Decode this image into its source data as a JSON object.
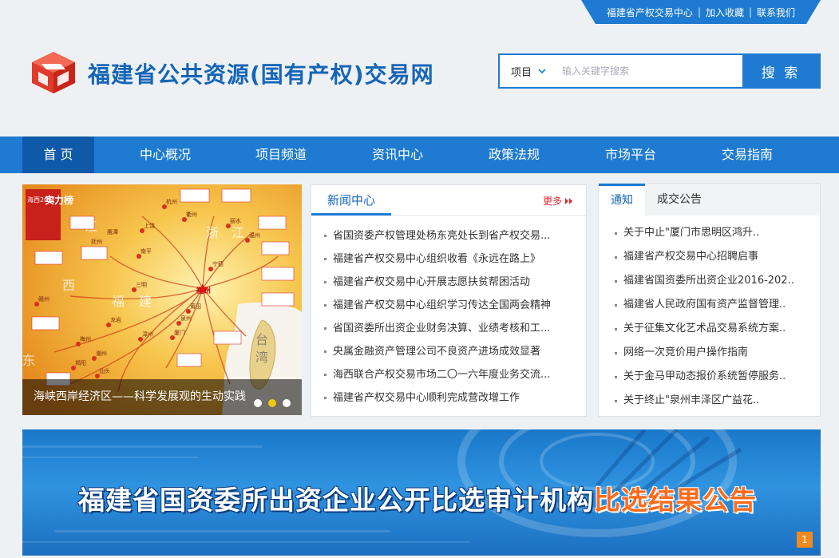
{
  "utility": {
    "links": [
      "福建省产权交易中心",
      "加入收藏",
      "联系我们"
    ],
    "separator": "|"
  },
  "header": {
    "title": "福建省公共资源(国有产权)交易网",
    "logo_icon": "cube-logo-icon"
  },
  "search": {
    "category": "项目",
    "placeholder": "输入关键字搜索",
    "button": "搜 索"
  },
  "nav": {
    "items": [
      "首 页",
      "中心概况",
      "项目频道",
      "资讯中心",
      "政策法规",
      "市场平台",
      "交易指南"
    ],
    "active_index": 0
  },
  "slider": {
    "caption": "海峡西岸经济区——科学发展观的生动实践",
    "slide_count": 3,
    "active_slide": 2,
    "image_text": {
      "badge_top": "实力榜",
      "badge_side": "海西20城",
      "city_main": "福州",
      "regions": [
        "江",
        "浙",
        "江",
        "西",
        "福",
        "建",
        "东",
        "台",
        "湾"
      ],
      "cities": [
        "杭州",
        "上饶",
        "衢州",
        "丽水",
        "温州",
        "宁德",
        "福州",
        "莆田",
        "三明",
        "南平",
        "泉州",
        "厦门",
        "漳州",
        "龙岩",
        "梅州",
        "潮州",
        "汕头",
        "揭阳",
        "赣州",
        "鹰潭",
        "抚州"
      ]
    }
  },
  "news": {
    "title": "新闻中心",
    "more": "更多",
    "items": [
      "省国资委产权管理处杨东亮处长到省产权交易...",
      "福建省产权交易中心组织收看《永远在路上》",
      "福建省产权交易中心开展志愿扶贫帮困活动",
      "福建省产权交易中心组织学习传达全国两会精神",
      "省国资委所出资企业财务决算、业绩考核和工...",
      "央属金融资产管理公司不良资产进场成效显著",
      "海西联合产权交易市场二〇一六年度业务交流...",
      "福建省产权交易中心顺利完成营改增工作"
    ]
  },
  "notice": {
    "tabs": [
      "通知",
      "成交公告"
    ],
    "active_tab": 0,
    "items": [
      "关于中止\"厦门市思明区鸿升..",
      "福建省产权交易中心招聘启事",
      "福建省国资委所出资企业2016-202..",
      "福建省人民政府国有资产监督管理..",
      "关于征集文化艺术品交易系统方案..",
      "网络一次竞价用户操作指南",
      "关于金马甲动态报价系统暂停服务..",
      "关于终止\"泉州丰泽区广益花.."
    ]
  },
  "banner": {
    "headline_white": "福建省国资委所出资企业公开比选审计机构",
    "headline_orange": "比选结果公告",
    "page_number": "1"
  },
  "colors": {
    "primary": "#1e7bd1",
    "nav_active": "#0f5aa8",
    "title_blue": "#1565b8",
    "more_red": "#e0262a",
    "logo_red": "#e03a2c",
    "banner_orange": "#ff6a1a"
  }
}
